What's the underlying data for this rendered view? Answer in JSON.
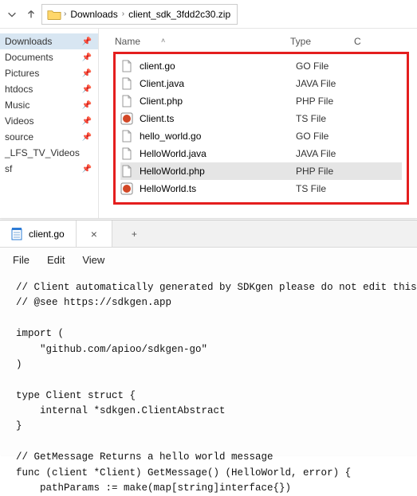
{
  "explorer": {
    "breadcrumb": {
      "parent": "Downloads",
      "current": "client_sdk_3fdd2c30.zip"
    },
    "sidebar": {
      "items": [
        {
          "label": "Downloads",
          "pinned": true,
          "active": true
        },
        {
          "label": "Documents",
          "pinned": true,
          "active": false
        },
        {
          "label": "Pictures",
          "pinned": true,
          "active": false
        },
        {
          "label": "htdocs",
          "pinned": true,
          "active": false
        },
        {
          "label": "Music",
          "pinned": true,
          "active": false
        },
        {
          "label": "Videos",
          "pinned": true,
          "active": false
        },
        {
          "label": "source",
          "pinned": true,
          "active": false
        },
        {
          "label": "_LFS_TV_Videos",
          "pinned": false,
          "active": false
        },
        {
          "label": "sf",
          "pinned": true,
          "active": false
        }
      ]
    },
    "columns": {
      "name": "Name",
      "type": "Type",
      "c": "C"
    },
    "files": [
      {
        "name": "client.go",
        "type": "GO File",
        "icon": "file",
        "selected": false
      },
      {
        "name": "Client.java",
        "type": "JAVA File",
        "icon": "file",
        "selected": false
      },
      {
        "name": "Client.php",
        "type": "PHP File",
        "icon": "file",
        "selected": false
      },
      {
        "name": "Client.ts",
        "type": "TS File",
        "icon": "ts",
        "selected": false
      },
      {
        "name": "hello_world.go",
        "type": "GO File",
        "icon": "file",
        "selected": false
      },
      {
        "name": "HelloWorld.java",
        "type": "JAVA File",
        "icon": "file",
        "selected": false
      },
      {
        "name": "HelloWorld.php",
        "type": "PHP File",
        "icon": "file",
        "selected": true
      },
      {
        "name": "HelloWorld.ts",
        "type": "TS File",
        "icon": "ts",
        "selected": false
      }
    ]
  },
  "editor": {
    "tab": {
      "title": "client.go",
      "close": "×",
      "plus": "+"
    },
    "menu": {
      "file": "File",
      "edit": "Edit",
      "view": "View"
    },
    "code": "// Client automatically generated by SDKgen please do not edit this file\n// @see https://sdkgen.app\n\nimport (\n    \"github.com/apioo/sdkgen-go\"\n)\n\ntype Client struct {\n    internal *sdkgen.ClientAbstract\n}\n\n// GetMessage Returns a hello world message\nfunc (client *Client) GetMessage() (HelloWorld, error) {\n    pathParams := make(map[string]interface{})"
  }
}
